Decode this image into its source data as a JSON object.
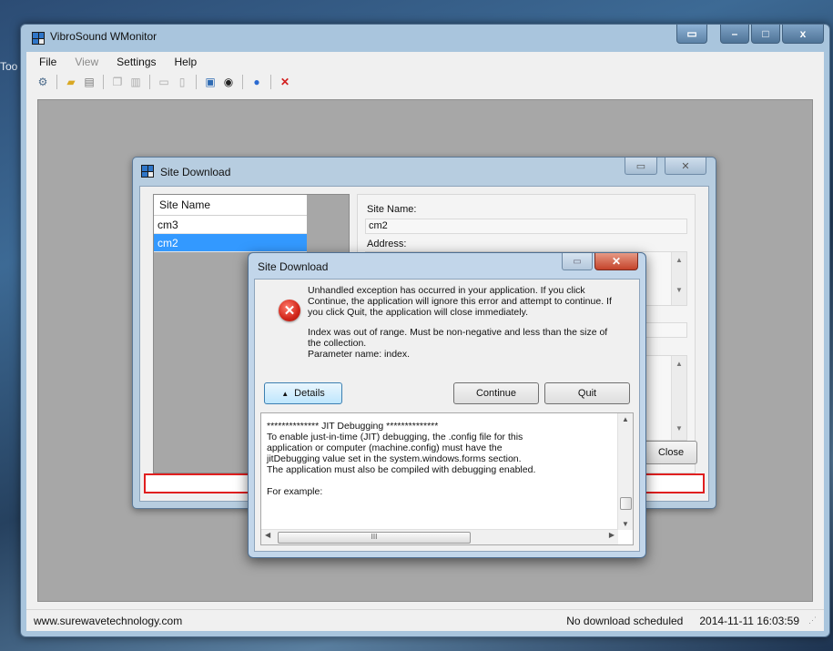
{
  "desktop": {
    "label": "Too"
  },
  "window": {
    "title": "VibroSound WMonitor",
    "controls": {
      "minimize": "–",
      "maximize": "□",
      "close": "x"
    }
  },
  "menu": {
    "items": [
      {
        "label": "File",
        "enabled": true
      },
      {
        "label": "View",
        "enabled": false
      },
      {
        "label": "Settings",
        "enabled": true
      },
      {
        "label": "Help",
        "enabled": true
      }
    ]
  },
  "toolbar": {
    "icons": [
      "connect-icon",
      "open-folder-icon",
      "print-icon",
      "copy-icon",
      "report-icon",
      "minimize-view-icon",
      "list-icon",
      "book-icon",
      "clock-icon",
      "help-icon",
      "exit-icon"
    ]
  },
  "status": {
    "website": "www.surewavetechnology.com",
    "schedule": "No download scheduled",
    "datetime": "2014-11-11 16:03:59"
  },
  "site_download": {
    "title": "Site Download",
    "list_header": "Site Name",
    "sites": [
      {
        "name": "cm3",
        "selected": false
      },
      {
        "name": "cm2",
        "selected": true
      }
    ],
    "site_name_label": "Site Name:",
    "site_name_value": "cm2",
    "address_label": "Address:",
    "close_label": "Close"
  },
  "error_dialog": {
    "title": "Site Download",
    "message1": "Unhandled exception has occurred in your application. If you click Continue, the application will ignore this error and attempt to continue. If you click Quit, the application will close immediately.",
    "message2": "Index was out of range. Must be non-negative and less than the size of the collection.",
    "message3": "Parameter name: index.",
    "details_label": "Details",
    "continue_label": "Continue",
    "quit_label": "Quit",
    "details_text": "************** JIT Debugging **************\nTo enable just-in-time (JIT) debugging, the .config file for this application or computer (machine.config) must have the jitDebugging value set in the system.windows.forms section.\nThe application must also be compiled with debugging enabled.\n\nFor example:",
    "hscroll_grip": "III"
  },
  "colors": {
    "selection": "#3399ff",
    "error_red": "#d1261a",
    "progress_border": "#e01f1f"
  }
}
